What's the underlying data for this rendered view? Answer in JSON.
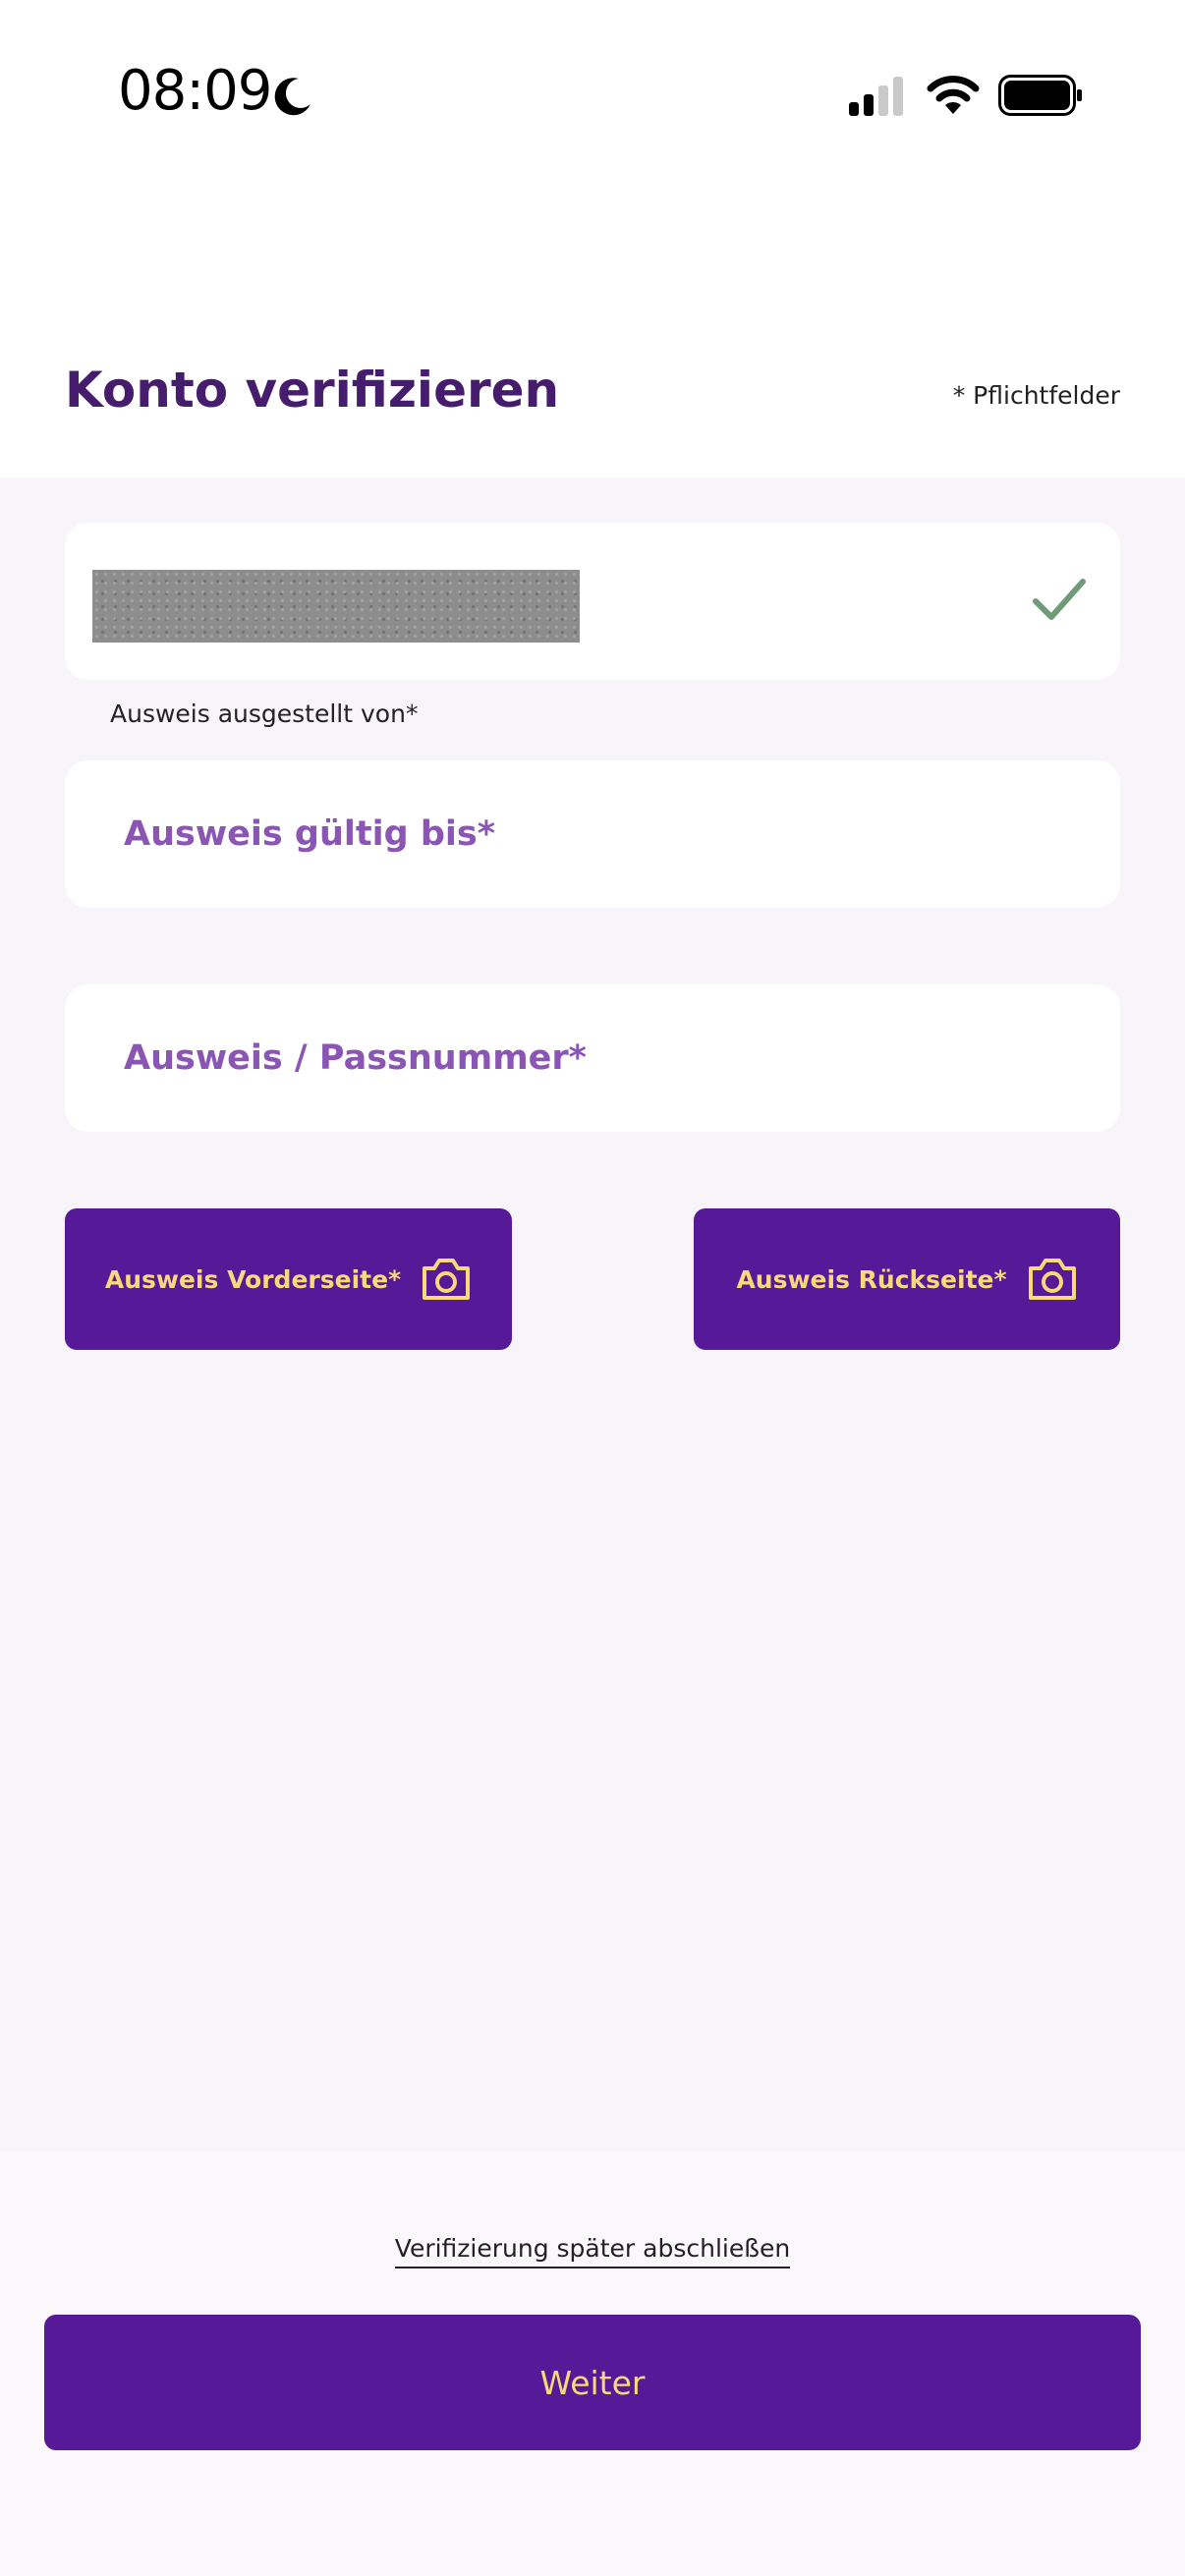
{
  "status_bar": {
    "time": "08:09"
  },
  "header": {
    "title": "Konto verifizieren",
    "required_note": "* Pflichtfelder"
  },
  "form": {
    "issuer_label": "Ausweis ausgestellt von*",
    "expiry_placeholder": "Ausweis gültig bis*",
    "passnumber_placeholder": "Ausweis / Passnummer*",
    "front_photo_label": "Ausweis Vorderseite*",
    "back_photo_label": "Ausweis Rückseite*"
  },
  "footer": {
    "later_link": "Verifizierung später abschließen",
    "next_button": "Weiter"
  },
  "colors": {
    "primary": "#561997",
    "title": "#461c6c",
    "accent_text": "#fbd97b",
    "placeholder": "#8b55b4",
    "check": "#6f9b78"
  },
  "icons": [
    "moon-icon",
    "signal-icon",
    "wifi-icon",
    "battery-icon",
    "check-icon",
    "camera-icon"
  ]
}
